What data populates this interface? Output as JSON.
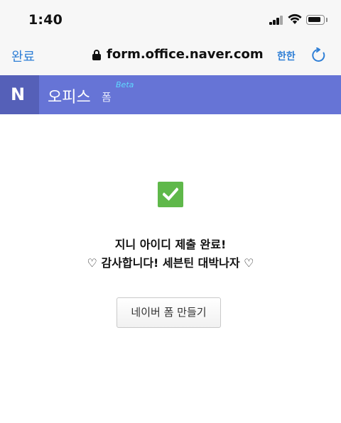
{
  "status_bar": {
    "time": "1:40"
  },
  "browser": {
    "done_label": "완료",
    "url": "form.office.naver.com",
    "translate_label": "한한"
  },
  "header": {
    "logo_letter": "N",
    "title": "오피스",
    "subtitle": "폼",
    "badge": "Beta",
    "color": "#6674d6"
  },
  "main": {
    "check_color": "#5fb84a",
    "message_line1": "지니 아이디 제출 완료!",
    "message_line2": "♡ 감사합니다! 세븐틴 대박나자 ♡",
    "make_form_label": "네이버 폼 만들기"
  }
}
